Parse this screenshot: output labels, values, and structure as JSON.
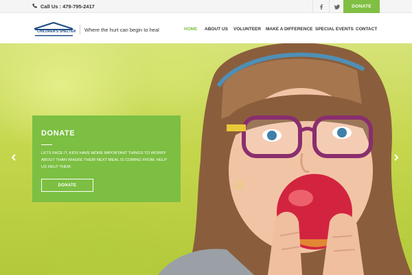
{
  "topbar": {
    "call_text": "Call Us : 479-795-2417",
    "donate_label": "DONATE",
    "social": [
      "facebook-icon",
      "twitter-icon"
    ]
  },
  "header": {
    "logo_text": "CHILDREN'S SHELTER",
    "tagline": "Where the hurt can begin to heal",
    "nav": [
      {
        "label": "HOME",
        "active": true
      },
      {
        "label": "ABOUT US",
        "active": false
      },
      {
        "label": "VOLUNTEER",
        "active": false
      },
      {
        "label": "MAKE A DIFFERENCE",
        "active": false
      },
      {
        "label": "SPECIAL EVENTS",
        "active": false
      },
      {
        "label": "CONTACT",
        "active": false
      }
    ]
  },
  "hero": {
    "panel": {
      "title": "DONATE",
      "body": "LETS FACE IT, KIDS HAVE MORE IMPORTANT THINGS TO WORRY ABOUT THAN WHERE THEIR NEXT MEAL IS COMING FROM. HELP US HELP THEM.",
      "button_label": "DONATE"
    },
    "prev_icon": "chevron-left-icon",
    "next_icon": "chevron-right-icon"
  },
  "colors": {
    "accent": "#80bf43",
    "logo_blue": "#1e4d86"
  }
}
